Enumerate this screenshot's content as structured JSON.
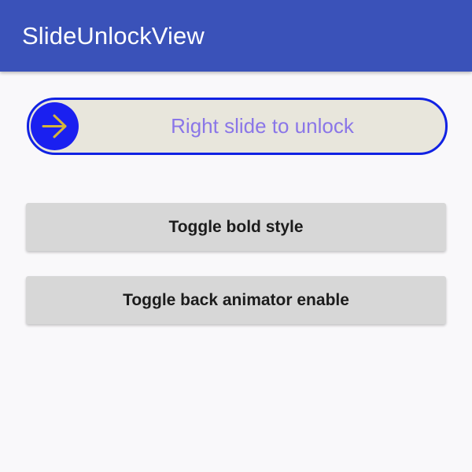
{
  "app_bar": {
    "title": "SlideUnlockView",
    "color": "#3a52b9"
  },
  "slide_unlock": {
    "label": "Right slide to unlock",
    "thumb_icon": "arrow-right-icon",
    "border_color": "#1122e3",
    "track_color": "#e8e6dc",
    "thumb_color": "#1a20f0",
    "icon_color": "#d4b43a",
    "label_color": "#8a76e8",
    "progress": 0
  },
  "buttons": {
    "toggle_bold": "Toggle bold style",
    "toggle_animator": "Toggle back animator enable"
  }
}
